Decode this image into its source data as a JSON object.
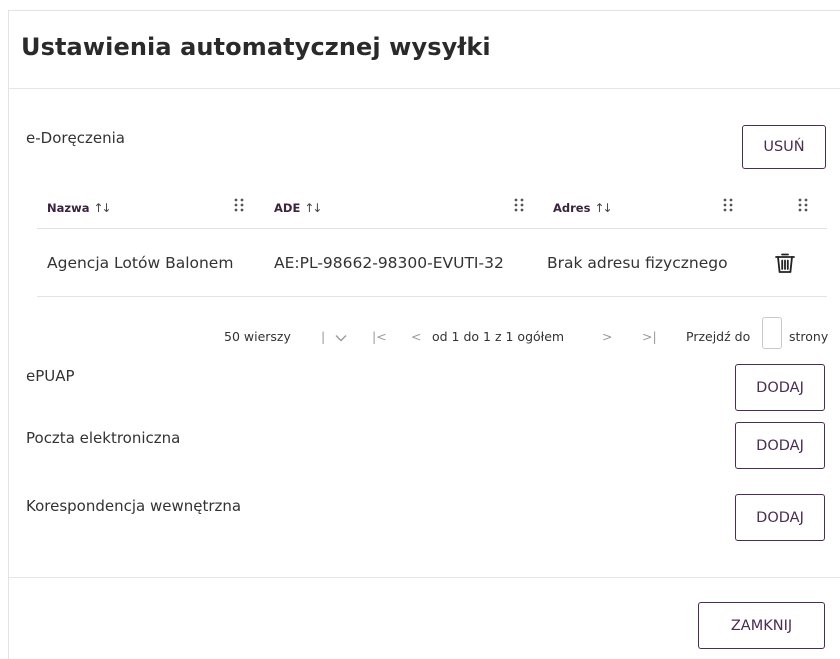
{
  "dialog": {
    "title": "Ustawienia automatycznej wysyłki",
    "close_label": "ZAMKNIJ"
  },
  "sections": {
    "edoreczenia": {
      "label": "e-Doręczenia",
      "remove_label": "USUŃ",
      "columns": [
        {
          "label": "Nazwa",
          "sort": "↑↓"
        },
        {
          "label": "ADE",
          "sort": "↑↓"
        },
        {
          "label": "Adres",
          "sort": "↑↓"
        }
      ],
      "rows": [
        {
          "name": "Agencja Lotów Balonem",
          "ade": "AE:PL-98662-98300-EVUTI-32",
          "address": "Brak adresu fizycznego"
        }
      ],
      "pager": {
        "rows_per_page": "50 wierszy",
        "first": "|<",
        "prev": "<",
        "range": "od 1 do 1 z 1 ogółem",
        "next": ">",
        "last": ">|",
        "goto_label": "Przejdź do",
        "goto_value": "",
        "pages_label": "strony"
      }
    },
    "epuap": {
      "label": "ePUAP",
      "add_label": "DODAJ"
    },
    "email": {
      "label": "Poczta elektroniczna",
      "add_label": "DODAJ"
    },
    "internal": {
      "label": "Korespondencja wewnętrzna",
      "add_label": "DODAJ"
    }
  },
  "icons": {
    "column_drag": "grip-icon",
    "delete": "trash-icon",
    "dropdown": "chevron-down-icon"
  },
  "colors": {
    "accent": "#4b2c52",
    "border": "#e3e3e3"
  }
}
